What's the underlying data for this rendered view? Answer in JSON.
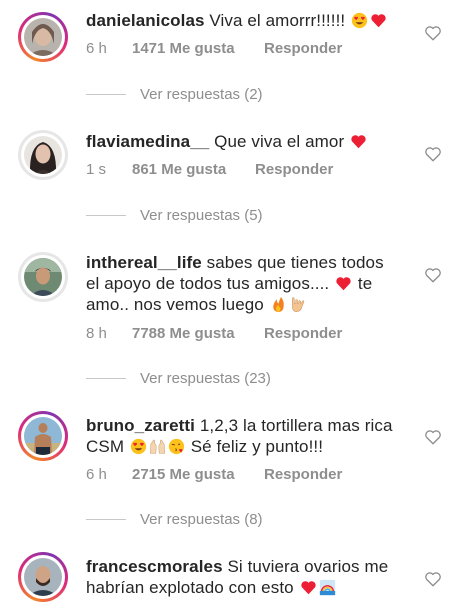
{
  "comments": [
    {
      "username": "danielanicolas",
      "text": "Viva el amorrr!!!!!!",
      "time": "6 h",
      "likes": "1471 Me gusta",
      "reply": "Responder",
      "view_replies": "Ver respuestas (2)",
      "emoji": [
        "smiling-face-heart-eyes",
        "red-heart"
      ]
    },
    {
      "username": "flaviamedina__",
      "text": "Que viva el amor",
      "time": "1 s",
      "likes": "861 Me gusta",
      "reply": "Responder",
      "view_replies": "Ver respuestas (5)",
      "emoji": [
        "red-heart"
      ]
    },
    {
      "username": "inthereal__life",
      "text_line1": "sabes que tienes todos",
      "text_line2": "el apoyo de todos tus amigos....",
      "text_line2b": "te",
      "text_line3": "amo.. nos vemos luego",
      "time": "8 h",
      "likes": "7788 Me gusta",
      "reply": "Responder",
      "view_replies": "Ver respuestas (23)",
      "emoji": [
        "red-heart",
        "fire",
        "love-you-gesture"
      ]
    },
    {
      "username": "bruno_zaretti",
      "text_line1": "1,2,3 la tortillera mas rica",
      "text_line2a": "CSM",
      "text_line2b": "Sé feliz y punto!!!",
      "time": "6 h",
      "likes": "2715 Me gusta",
      "reply": "Responder",
      "view_replies": "Ver respuestas (8)",
      "emoji": [
        "smiling-face-heart-eyes",
        "raising-hands",
        "face-blowing-kiss"
      ]
    },
    {
      "username": "francescmorales",
      "text_line1": "Si tuviera ovarios me",
      "text_line2": "habrían explotado con esto",
      "emoji": [
        "red-heart",
        "rainbow"
      ]
    }
  ],
  "colors": {
    "username": "#262626",
    "secondary": "#8e8e8e",
    "heart_red": "#ed1f34",
    "story_ring": "#dd2a7b"
  }
}
